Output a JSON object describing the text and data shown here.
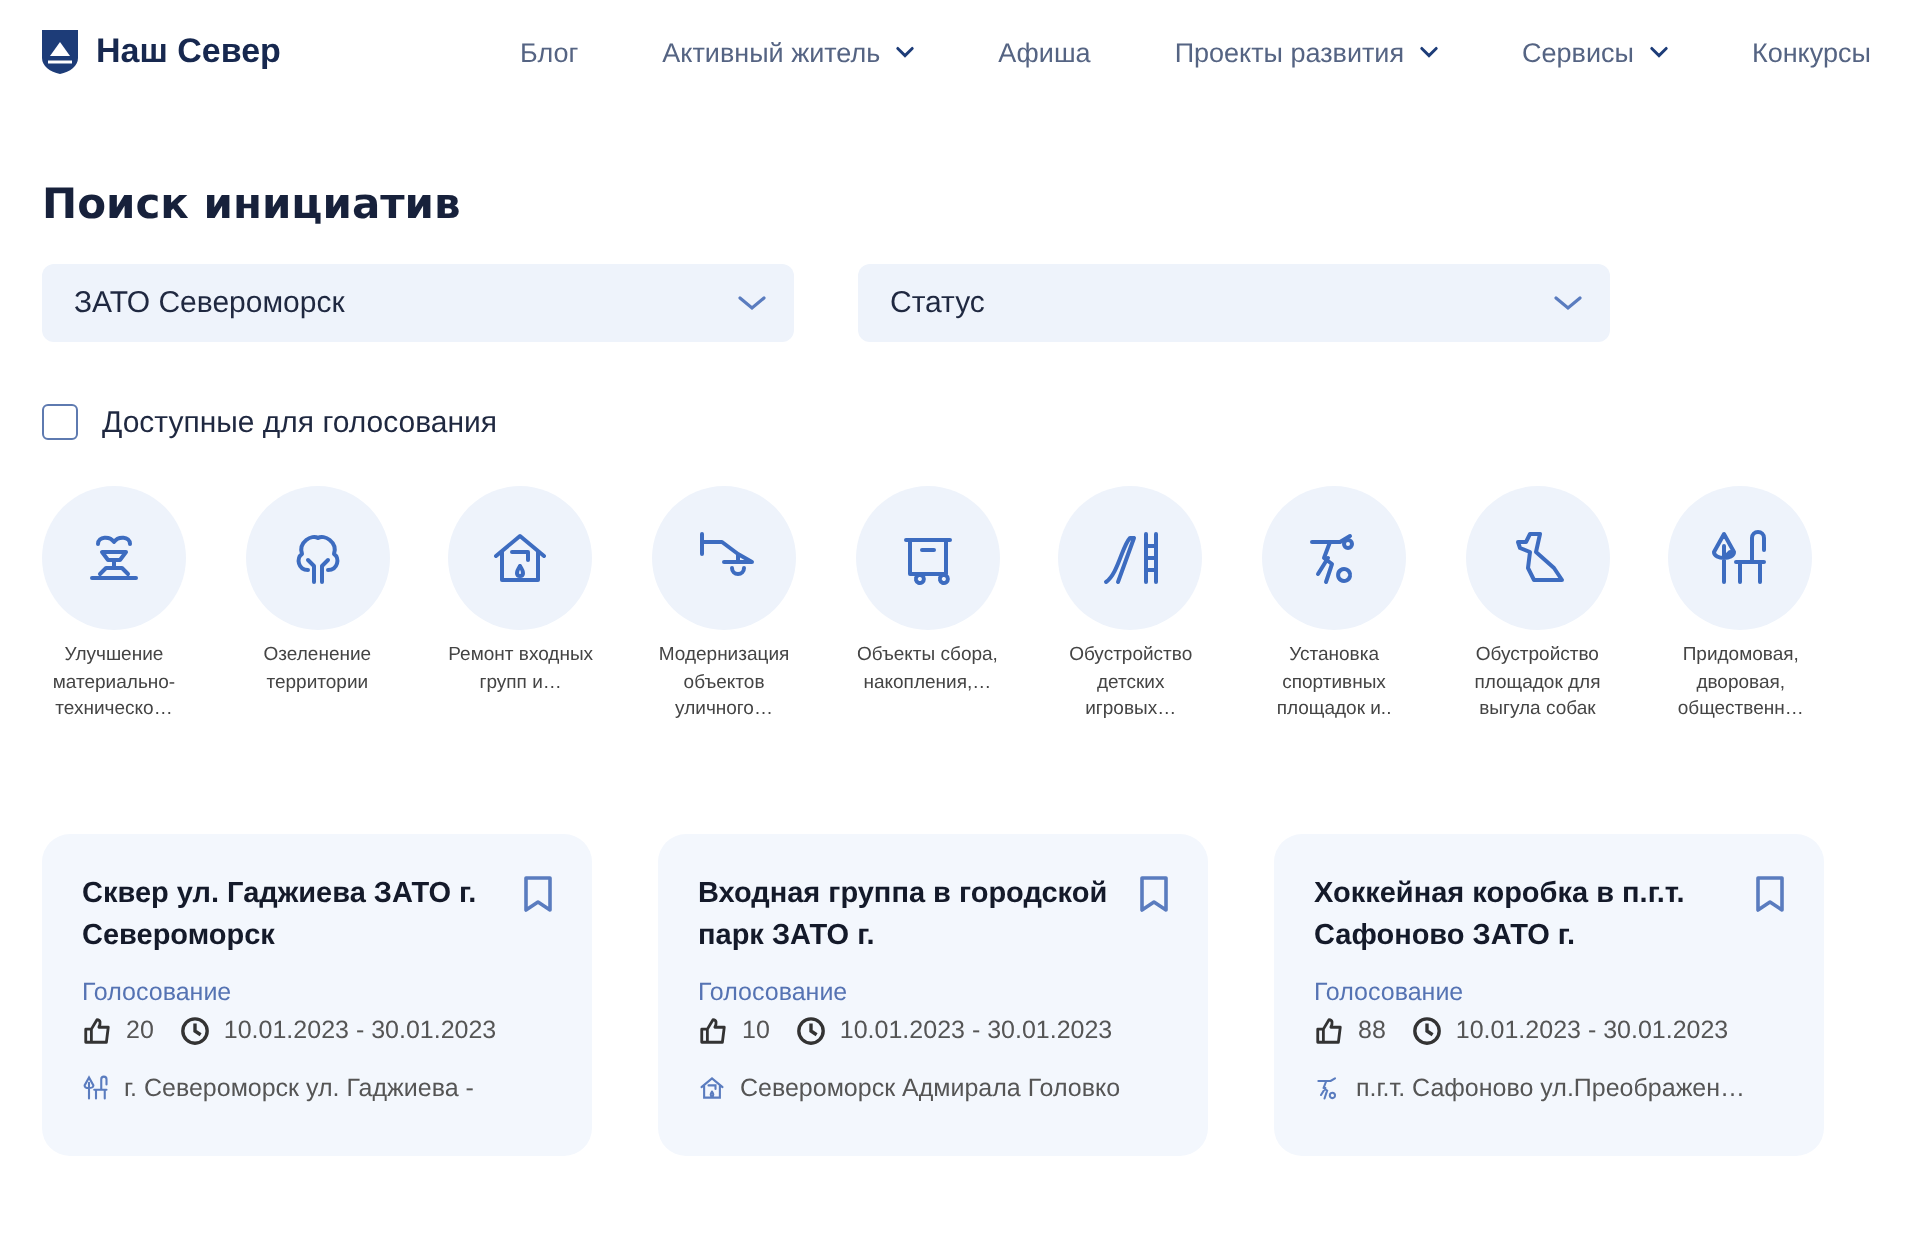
{
  "header": {
    "logo": "Наш Север",
    "nav": [
      {
        "label": "Блог",
        "has_menu": false
      },
      {
        "label": "Активный житель",
        "has_menu": true
      },
      {
        "label": "Афиша",
        "has_menu": false
      },
      {
        "label": "Проекты развития",
        "has_menu": true
      },
      {
        "label": "Сервисы",
        "has_menu": true
      },
      {
        "label": "Конкурсы",
        "has_menu": false
      }
    ]
  },
  "title": "Поиск инициатив",
  "filters": [
    {
      "value": "ЗАТО Североморск"
    },
    {
      "value": "Статус"
    }
  ],
  "voting_filter": {
    "label": "Доступные для голосования",
    "checked": false
  },
  "categories": [
    {
      "kind": "fountain",
      "label": "Улучшение материально-техническо…"
    },
    {
      "kind": "tree",
      "label": "Озеленение территории"
    },
    {
      "kind": "house",
      "label": "Ремонт входных групп и…"
    },
    {
      "kind": "lamp",
      "label": "Модернизация объектов уличного…"
    },
    {
      "kind": "bin",
      "label": "Объекты сбора, накопления,…"
    },
    {
      "kind": "slide",
      "label": "Обустройство детских игровых…"
    },
    {
      "kind": "sport",
      "label": "Установка спортивных площадок и.."
    },
    {
      "kind": "dog",
      "label": "Обустройство площадок для выгула собак"
    },
    {
      "kind": "yard",
      "label": "Придомовая, дворовая, общественн…"
    }
  ],
  "cards": [
    {
      "title": "Сквер ул. Гаджиева ЗАТО г. Североморск",
      "status": "Голосование",
      "likes": "20",
      "dates": "10.01.2023 - 30.01.2023",
      "kind": "yard",
      "address": "г. Североморск ул. Гаджиева -"
    },
    {
      "title": "Входная группа в городской парк ЗАТО г.",
      "status": "Голосование",
      "likes": "10",
      "dates": "10.01.2023 - 30.01.2023",
      "kind": "house",
      "address": "Североморск Адмирала Головко"
    },
    {
      "title": "Хоккейная коробка в п.г.т. Сафоново ЗАТО г.",
      "status": "Голосование",
      "likes": "88",
      "dates": "10.01.2023 - 30.01.2023",
      "kind": "sport",
      "address": "п.г.т. Сафоново ул.Преображен…"
    }
  ]
}
